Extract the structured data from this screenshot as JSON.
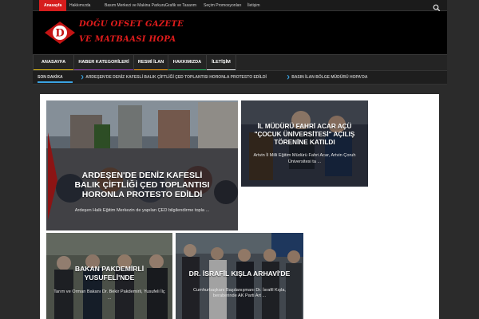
{
  "topbar": {
    "links": [
      "Anasayfa",
      "Hakkımızda",
      "Basım Merkezi ve Makina Parkuru",
      "Grafik ve Tasarım",
      "Seçim Promosyonları",
      "İletişim"
    ]
  },
  "header": {
    "logo_letter": "D",
    "logo_line1": "DOĞU OFSET GAZETE",
    "logo_line2": "VE MATBAASI HOPA"
  },
  "nav": {
    "items": [
      {
        "label": "ANASAYFA",
        "color": "#e8c21a"
      },
      {
        "label": "HABER KATEGORİLERİ",
        "color": "#8e44ad"
      },
      {
        "label": "RESMİ İLAN",
        "color": "#f39c12"
      },
      {
        "label": "HAKKIMIZDA",
        "color": "#27ae60"
      },
      {
        "label": "İLETİŞİM",
        "color": "#ecf0f1"
      }
    ]
  },
  "ticker": {
    "label": "SON DAKİKA",
    "items": [
      "ARDEŞEN'DE DENİZ KAFESLİ BALIK ÇİFTLİĞİ ÇED TOPLANTISI HORONLA PROTESTO EDİLDİ",
      "BASIN İLAN BÖLGE MÜDÜRÜ HOPA'DA"
    ]
  },
  "cards": [
    {
      "title": "ARDEŞEN'DE DENİZ KAFESLİ BALIK ÇİFTLİĞİ ÇED TOPLANTISI HORONLA PROTESTO EDİLDİ",
      "excerpt": "Ardeşen Halk Eğitim Merkezin de yapılan ÇED bilgilendirme topla ..."
    },
    {
      "title": "İL MÜDÜRÜ FAHRİ ACAR AÇÜ \"ÇOCUK ÜNİVERSİTESİ\" AÇILIŞ TÖRENİNE KATILDI",
      "excerpt": "Artvin İl Milli Eğitim Müdürü Fahri Acar, Artvin Çoruh Üniversitesi ta ..."
    },
    {
      "title": "BAKAN PAKDEMİRLİ YUSUFELİ'NDE",
      "excerpt": "Tarım ve Orman Bakanı Dr. Bekir Pakdemirli, Yusufeli İlç ..."
    },
    {
      "title": "DR. İSRAFİL KIŞLA ARHAVİ'DE",
      "excerpt": "Cumhurbaşkanı Başdanışmanı Dr. İsrafil Kışla, beraberinde AK Parti Art ..."
    }
  ]
}
